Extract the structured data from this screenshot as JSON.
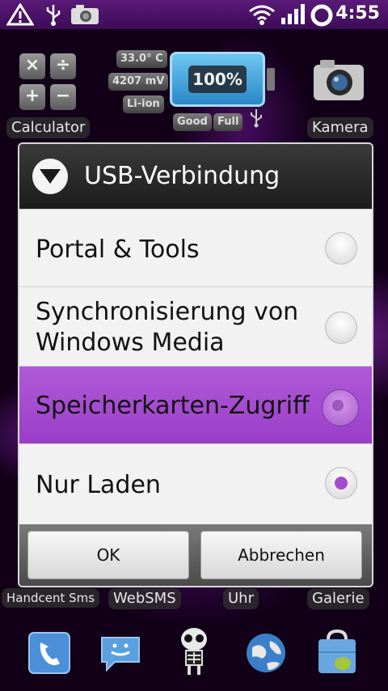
{
  "status_bar": {
    "time": "4:55",
    "icons": [
      "warning-icon",
      "usb-icon",
      "camera-notification-icon",
      "wifi-icon",
      "signal-icon",
      "battery-ring-icon"
    ]
  },
  "home": {
    "calculator_label": "Calculator",
    "calc_keys": [
      "×",
      "÷",
      "+",
      "−"
    ],
    "battery_widget": {
      "temperature": "33.0° C",
      "voltage": "4207 mV",
      "type": "Li-ion",
      "percent_text": "100%",
      "percent": 100,
      "health": "Good",
      "status": "Full"
    },
    "camera_label": "Kamera",
    "bottom_labels": [
      "Handcent Sms",
      "WebSMS",
      "Uhr",
      "Galerie"
    ]
  },
  "dialog": {
    "title": "USB-Verbindung",
    "options": [
      {
        "label": "Portal & Tools",
        "selected": false
      },
      {
        "label_line1": "Synchronisierung von",
        "label_line2": "Windows Media",
        "selected": false
      },
      {
        "label": "Speicherkarten-Zugriff",
        "selected": false,
        "pressed": true
      },
      {
        "label": "Nur Laden",
        "selected": true
      }
    ],
    "ok_label": "OK",
    "cancel_label": "Abbrechen"
  },
  "dock": {
    "icons": [
      "phone-icon",
      "messaging-icon",
      "skeleton-app-icon",
      "browser-globe-icon",
      "market-icon"
    ]
  },
  "colors": {
    "accent": "#a24cd0",
    "status_bar": "#4a1266",
    "selected_row": "#a64ed2"
  }
}
